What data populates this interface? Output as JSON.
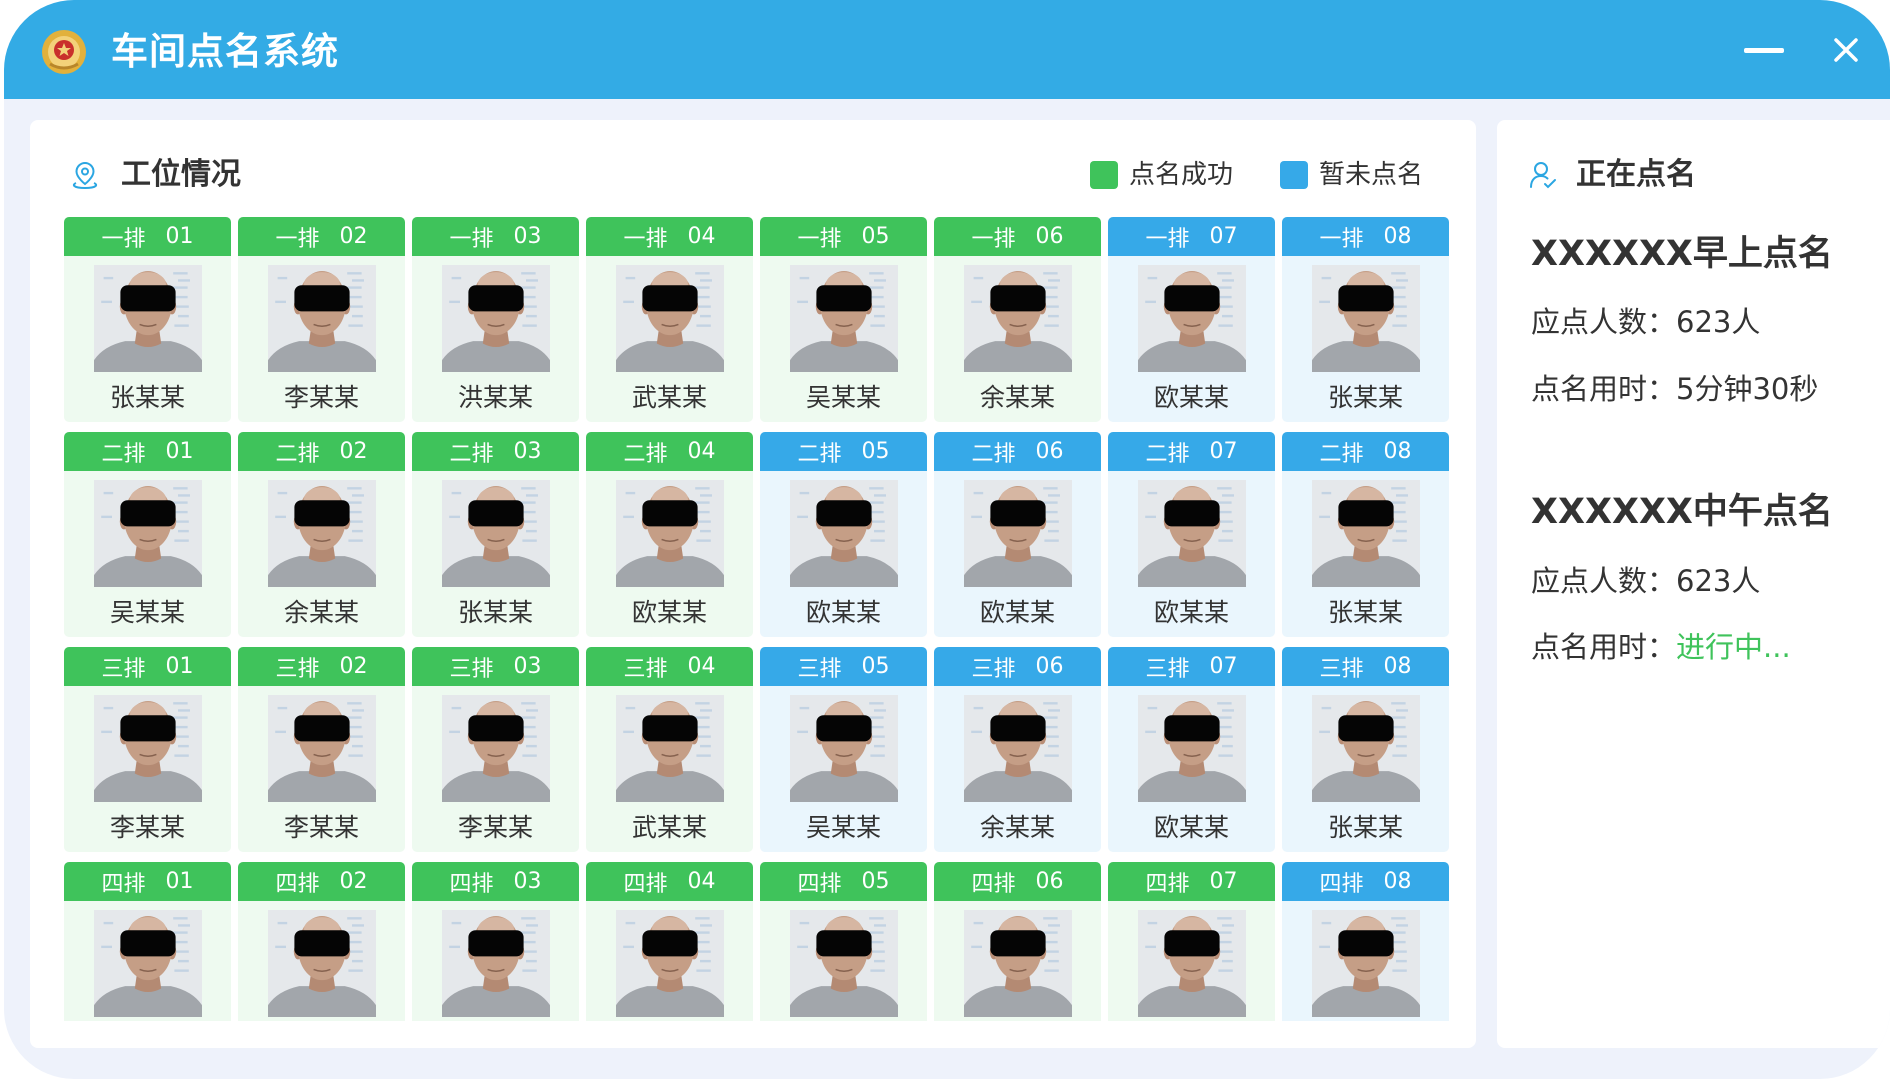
{
  "app": {
    "title": "车间点名系统",
    "logo_icon": "emblem-logo"
  },
  "window_controls": {
    "minimize_icon": "minimize-icon",
    "close_icon": "close-icon"
  },
  "colors": {
    "header": "#33abe5",
    "called": "#3fc35b",
    "called_bg": "#eefaf0",
    "pending": "#36a9e8",
    "pending_bg": "#eaf6fd",
    "page_bg": "#eef2fb",
    "in_progress_text": "#3fc35b"
  },
  "workstations": {
    "title": "工位情况",
    "icon": "location-pin-icon",
    "legend": [
      {
        "label": "点名成功",
        "called": true
      },
      {
        "label": "暂未点名",
        "called": false
      }
    ],
    "rows": [
      {
        "label": "一排",
        "cells": [
          {
            "number": "01",
            "name": "张某某",
            "called": true
          },
          {
            "number": "02",
            "name": "李某某",
            "called": true
          },
          {
            "number": "03",
            "name": "洪某某",
            "called": true
          },
          {
            "number": "04",
            "name": "武某某",
            "called": true
          },
          {
            "number": "05",
            "name": "吴某某",
            "called": true
          },
          {
            "number": "06",
            "name": "余某某",
            "called": true
          },
          {
            "number": "07",
            "name": "欧某某",
            "called": false
          },
          {
            "number": "08",
            "name": "张某某",
            "called": false
          }
        ]
      },
      {
        "label": "二排",
        "cells": [
          {
            "number": "01",
            "name": "吴某某",
            "called": true
          },
          {
            "number": "02",
            "name": "余某某",
            "called": true
          },
          {
            "number": "03",
            "name": "张某某",
            "called": true
          },
          {
            "number": "04",
            "name": "欧某某",
            "called": true
          },
          {
            "number": "05",
            "name": "欧某某",
            "called": false
          },
          {
            "number": "06",
            "name": "欧某某",
            "called": false
          },
          {
            "number": "07",
            "name": "欧某某",
            "called": false
          },
          {
            "number": "08",
            "name": "张某某",
            "called": false
          }
        ]
      },
      {
        "label": "三排",
        "cells": [
          {
            "number": "01",
            "name": "李某某",
            "called": true
          },
          {
            "number": "02",
            "name": "李某某",
            "called": true
          },
          {
            "number": "03",
            "name": "李某某",
            "called": true
          },
          {
            "number": "04",
            "name": "武某某",
            "called": true
          },
          {
            "number": "05",
            "name": "吴某某",
            "called": false
          },
          {
            "number": "06",
            "name": "余某某",
            "called": false
          },
          {
            "number": "07",
            "name": "欧某某",
            "called": false
          },
          {
            "number": "08",
            "name": "张某某",
            "called": false
          }
        ]
      },
      {
        "label": "四排",
        "cells": [
          {
            "number": "01",
            "called": true
          },
          {
            "number": "02",
            "called": true
          },
          {
            "number": "03",
            "called": true
          },
          {
            "number": "04",
            "called": true
          },
          {
            "number": "05",
            "called": true
          },
          {
            "number": "06",
            "called": true
          },
          {
            "number": "07",
            "called": true
          },
          {
            "number": "08",
            "called": false
          }
        ]
      }
    ]
  },
  "roll_call": {
    "title": "正在点名",
    "icon": "user-check-icon",
    "sessions": [
      {
        "name": "XXXXXX早上点名",
        "expected_label": "应点人数：",
        "expected_value": "623人",
        "duration_label": "点名用时：",
        "duration_value": "5分钟30秒",
        "in_progress": false
      },
      {
        "name": "XXXXXX中午点名",
        "expected_label": "应点人数：",
        "expected_value": "623人",
        "duration_label": "点名用时：",
        "duration_value": "进行中...",
        "in_progress": true
      }
    ]
  }
}
